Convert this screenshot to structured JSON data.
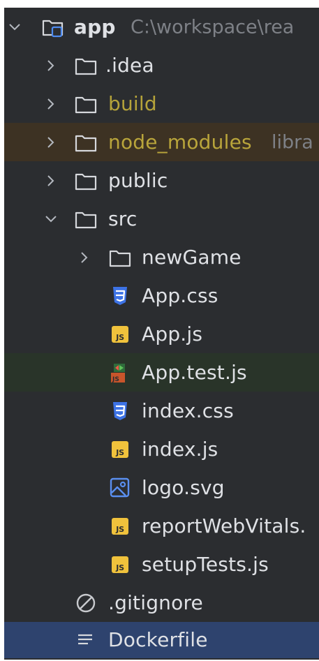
{
  "colors": {
    "panel": "#2b2d30",
    "text": "#dfe1e5",
    "hint": "#7e8187",
    "excluded_text": "#b9a53b",
    "excluded_bg": "#3d3223",
    "changed_bg": "#293429",
    "selected_bg": "#2e436e",
    "css_icon": "#3d73e6",
    "js_icon": "#f0c23c"
  },
  "tree": {
    "root": {
      "label": "app",
      "path": "C:\\workspace\\rea",
      "icon": "module-folder-icon"
    },
    "items": [
      {
        "label": ".idea",
        "icon": "folder-icon"
      },
      {
        "label": "build",
        "icon": "folder-icon",
        "status": "excluded"
      },
      {
        "label": "node_modules",
        "hint": "libra",
        "icon": "folder-icon",
        "status": "library"
      },
      {
        "label": "public",
        "icon": "folder-icon"
      },
      {
        "label": "src",
        "icon": "folder-icon",
        "expanded": true
      },
      {
        "label": "newGame",
        "icon": "folder-icon"
      },
      {
        "label": "App.css",
        "icon": "css-file-icon"
      },
      {
        "label": "App.js",
        "icon": "js-file-icon"
      },
      {
        "label": "App.test.js",
        "icon": "js-test-file-icon"
      },
      {
        "label": "index.css",
        "icon": "css-file-icon"
      },
      {
        "label": "index.js",
        "icon": "js-file-icon"
      },
      {
        "label": "logo.svg",
        "icon": "svg-file-icon"
      },
      {
        "label": "reportWebVitals.",
        "icon": "js-file-icon"
      },
      {
        "label": "setupTests.js",
        "icon": "js-file-icon"
      },
      {
        "label": ".gitignore",
        "icon": "ignore-file-icon"
      },
      {
        "label": "Dockerfile",
        "icon": "text-file-icon",
        "selected": true
      }
    ],
    "js_badge": "JS"
  }
}
